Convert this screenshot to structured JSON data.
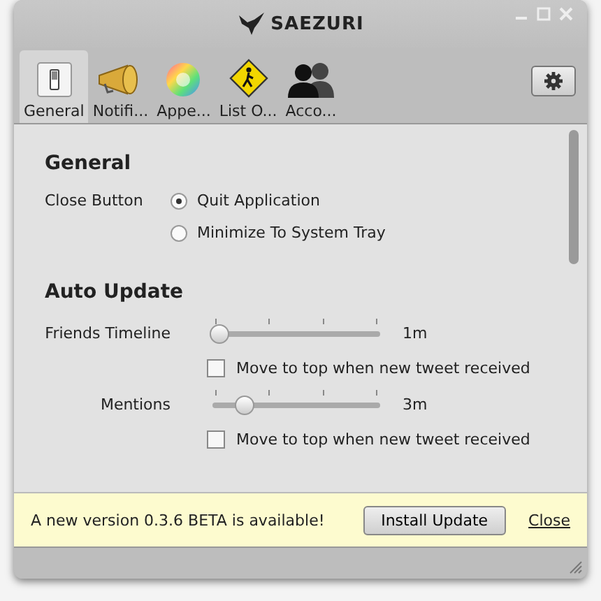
{
  "window": {
    "title": "SAEZURI"
  },
  "tabs": [
    {
      "label": "General",
      "kind": "switch",
      "selected": true
    },
    {
      "label": "Notifi...",
      "kind": "megaphone",
      "selected": false
    },
    {
      "label": "Appe...",
      "kind": "colorwheel",
      "selected": false
    },
    {
      "label": "List O...",
      "kind": "sign",
      "selected": false
    },
    {
      "label": "Acco...",
      "kind": "people",
      "selected": false
    }
  ],
  "sections": [
    {
      "title": "General",
      "rows": [
        {
          "kind": "radio",
          "label": "Close Button",
          "options": [
            {
              "label": "Quit Application",
              "selected": true
            },
            {
              "label": "Minimize To System Tray",
              "selected": false
            }
          ]
        }
      ]
    },
    {
      "title": "Auto Update",
      "rows": [
        {
          "kind": "slider",
          "label": "Friends Timeline",
          "level": 0,
          "reading": "1m"
        },
        {
          "kind": "checkbox",
          "label": "Move to top when new tweet received",
          "checked": false
        },
        {
          "kind": "slider",
          "label": "Mentions",
          "level": 0.15,
          "reading": "3m"
        },
        {
          "kind": "checkbox",
          "label": "Move to top when new tweet received",
          "checked": false
        }
      ]
    }
  ],
  "notification": {
    "message": "A new version 0.3.6 BETA is available!",
    "button": "Install Update",
    "link": "Close"
  }
}
